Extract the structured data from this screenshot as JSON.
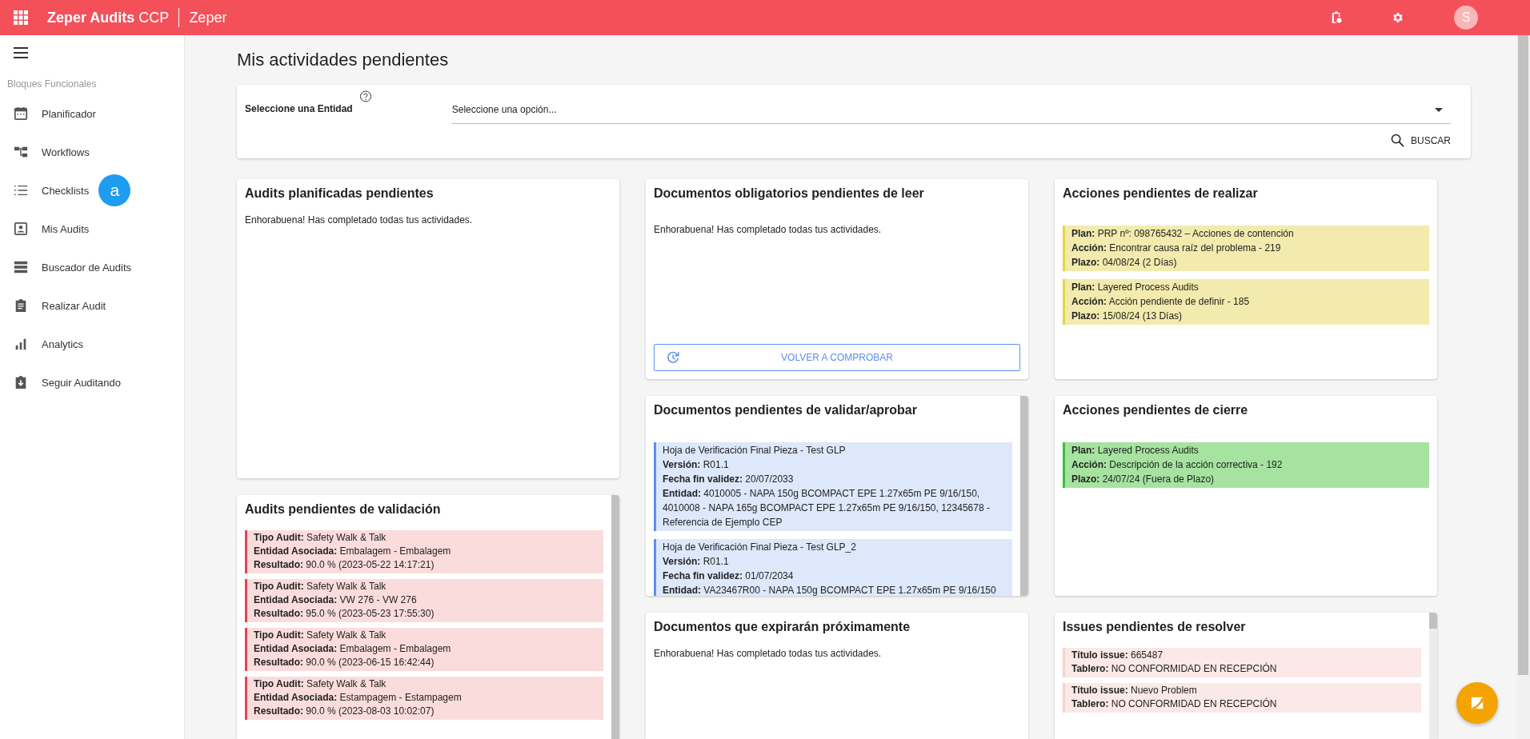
{
  "topbar": {
    "title": "**Zeper Audits** CCP",
    "subtitle": "Zeper",
    "avatar": "S"
  },
  "sidebar": {
    "section": "Bloques Funcionales",
    "items": [
      {
        "label": "Planificador"
      },
      {
        "label": "Workflows"
      },
      {
        "label": "Checklists",
        "badge": "a"
      },
      {
        "label": "Mis Audits"
      },
      {
        "label": "Buscador de Audits"
      },
      {
        "label": "Realizar Audit"
      },
      {
        "label": "Analytics"
      },
      {
        "label": "Seguir Auditando"
      }
    ]
  },
  "page_title": "Mis actividades pendientes",
  "filter": {
    "label": "Seleccione una Entidad",
    "placeholder": "Seleccione una opción...",
    "button": "BUSCAR"
  },
  "columns": [
    [
      {
        "title": "Audits planificadas pendientes",
        "kind": "empty",
        "message": "Enhorabuena! Has completado todas tus actividades."
      },
      {
        "title": "Audits pendientes de validación",
        "kind": "audits",
        "items": [
          {
            "fields": [
              {
                "label": "Tipo Audit:",
                "value": "Safety Walk & Talk"
              },
              {
                "label": "Entidad Asociada:",
                "value": "Embalagem - Embalagem"
              },
              {
                "label": "Resultado:",
                "value": "90.0 % (2023-05-22 14:17:21)"
              }
            ]
          },
          {
            "fields": [
              {
                "label": "Tipo Audit:",
                "value": "Safety Walk & Talk"
              },
              {
                "label": "Entidad Asociada:",
                "value": "VW 276 - VW 276"
              },
              {
                "label": "Resultado:",
                "value": "95.0 % (2023-05-23 17:55:30)"
              }
            ]
          },
          {
            "fields": [
              {
                "label": "Tipo Audit:",
                "value": "Safety Walk & Talk"
              },
              {
                "label": "Entidad Asociada:",
                "value": "Embalagem - Embalagem"
              },
              {
                "label": "Resultado:",
                "value": "90.0 % (2023-06-15 16:42:44)"
              }
            ]
          },
          {
            "fields": [
              {
                "label": "Tipo Audit:",
                "value": "Safety Walk & Talk"
              },
              {
                "label": "Entidad Asociada:",
                "value": "Estampagem - Estampagem"
              },
              {
                "label": "Resultado:",
                "value": "90.0 % (2023-08-03 10:02:07)"
              }
            ]
          }
        ]
      }
    ],
    [
      {
        "title": "Documentos obligatorios pendientes de leer",
        "kind": "empty",
        "message": "Enhorabuena! Has completado todas tus actividades.",
        "button": "VOLVER A COMPROBAR"
      },
      {
        "title": "Documentos pendientes de validar/aprobar",
        "kind": "documents",
        "items": [
          {
            "heading": "Hoja de Verificación Final Pieza - Test GLP",
            "fields": [
              {
                "label": "Versión:",
                "value": "R01.1"
              },
              {
                "label": "Fecha fin validez:",
                "value": "20/07/2033"
              },
              {
                "label": "Entidad:",
                "value": "4010005 - NAPA 150g BCOMPACT EPE 1.27x65m PE 9/16/150, 4010008 - NAPA 165g BCOMPACT EPE 1.27x65m PE 9/16/150, 12345678 - Referencia de Ejemplo CEP"
              }
            ]
          },
          {
            "heading": "Hoja de Verificación Final Pieza - Test GLP_2",
            "fields": [
              {
                "label": "Versión:",
                "value": "R01.1"
              },
              {
                "label": "Fecha fin validez:",
                "value": "01/07/2034"
              },
              {
                "label": "Entidad:",
                "value": "VA23467R00 - NAPA 150g BCOMPACT EPE 1.27x65m PE 9/16/150"
              }
            ]
          }
        ]
      },
      {
        "title": "Documentos que expirarán próximamente",
        "kind": "empty",
        "message": "Enhorabuena! Has completado todas tus actividades."
      }
    ],
    [
      {
        "title": "Acciones pendientes de realizar",
        "kind": "actions",
        "items": [
          {
            "fields": [
              {
                "label": "Plan:",
                "value": "PRP nº: 098765432 – Acciones de contención"
              },
              {
                "label": "Acción:",
                "value": "Encontrar causa raíz del problema - 219"
              },
              {
                "label": "Plazo:",
                "value": "04/08/24 (2 Días)"
              }
            ]
          },
          {
            "fields": [
              {
                "label": "Plan:",
                "value": "Layered Process Audits"
              },
              {
                "label": "Acción:",
                "value": "Acción pendiente de definir - 185"
              },
              {
                "label": "Plazo:",
                "value": "15/08/24 (13 Días)"
              }
            ]
          }
        ]
      },
      {
        "title": "Acciones pendientes de cierre",
        "kind": "closures",
        "items": [
          {
            "fields": [
              {
                "label": "Plan:",
                "value": "Layered Process Audits"
              },
              {
                "label": "Acción:",
                "value": "Descripción de la acción correctiva - 192"
              },
              {
                "label": "Plazo:",
                "value": "24/07/24 (Fuera de Plazo)"
              }
            ]
          }
        ]
      },
      {
        "title": "Issues pendientes de resolver",
        "kind": "issues",
        "items": [
          {
            "fields": [
              {
                "label": "Título issue:",
                "value": "665487"
              },
              {
                "label": "Tablero:",
                "value": "NO CONFORMIDAD EN RECEPCIÓN"
              }
            ]
          },
          {
            "fields": [
              {
                "label": "Título issue:",
                "value": "Nuevo Problem"
              },
              {
                "label": "Tablero:",
                "value": "NO CONFORMIDAD EN RECEPCIÓN"
              }
            ]
          }
        ]
      }
    ]
  ]
}
